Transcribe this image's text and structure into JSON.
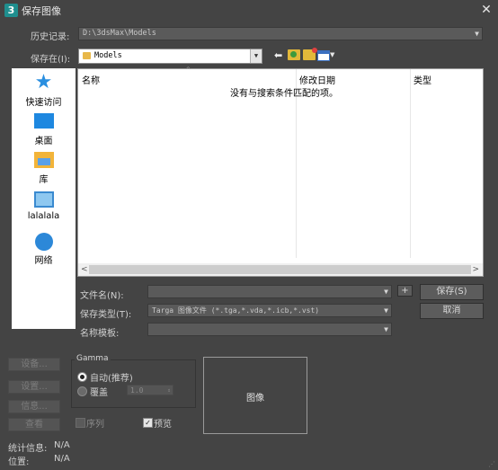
{
  "window": {
    "title": "保存图像",
    "app_icon_glyph": "3"
  },
  "history": {
    "label": "历史记录:",
    "value": "D:\\3dsMax\\Models"
  },
  "save_in": {
    "label": "保存在(I):",
    "value": "Models"
  },
  "toolbar": {
    "back_icon": "back-arrow-icon",
    "up_icon": "up-folder-icon",
    "new_folder_icon": "new-folder-icon",
    "view_icon": "view-menu-icon"
  },
  "places": [
    {
      "label": "快速访问",
      "icon": "star-icon"
    },
    {
      "label": "桌面",
      "icon": "desktop-icon"
    },
    {
      "label": "库",
      "icon": "library-icon"
    },
    {
      "label": "lalalala",
      "icon": "computer-icon"
    },
    {
      "label": "网络",
      "icon": "network-icon"
    }
  ],
  "file_list": {
    "columns": [
      "名称",
      "修改日期",
      "类型"
    ],
    "empty_message": "没有与搜索条件匹配的项。"
  },
  "filename": {
    "label": "文件名(N):",
    "value": ""
  },
  "save_type": {
    "label": "保存类型(T):",
    "value": "Targa 图像文件 (*.tga,*.vda,*.icb,*.vst)"
  },
  "name_template": {
    "label": "名称模板:",
    "value": ""
  },
  "buttons": {
    "plus": "+",
    "save": "保存(S)",
    "cancel": "取消"
  },
  "left_buttons": [
    "设备...",
    "设置...",
    "信息...",
    "查看"
  ],
  "gamma": {
    "title": "Gamma",
    "auto_label": "自动(推荐)",
    "override_label": "覆盖",
    "override_value": "1.0",
    "auto_selected": true
  },
  "sequence_label": "序列",
  "preview_label": "预览",
  "preview_checked": true,
  "preview_box_label": "图像",
  "stats": {
    "label": "统计信息:",
    "value": "N/A"
  },
  "location": {
    "label": "位置:",
    "value": "N/A"
  }
}
